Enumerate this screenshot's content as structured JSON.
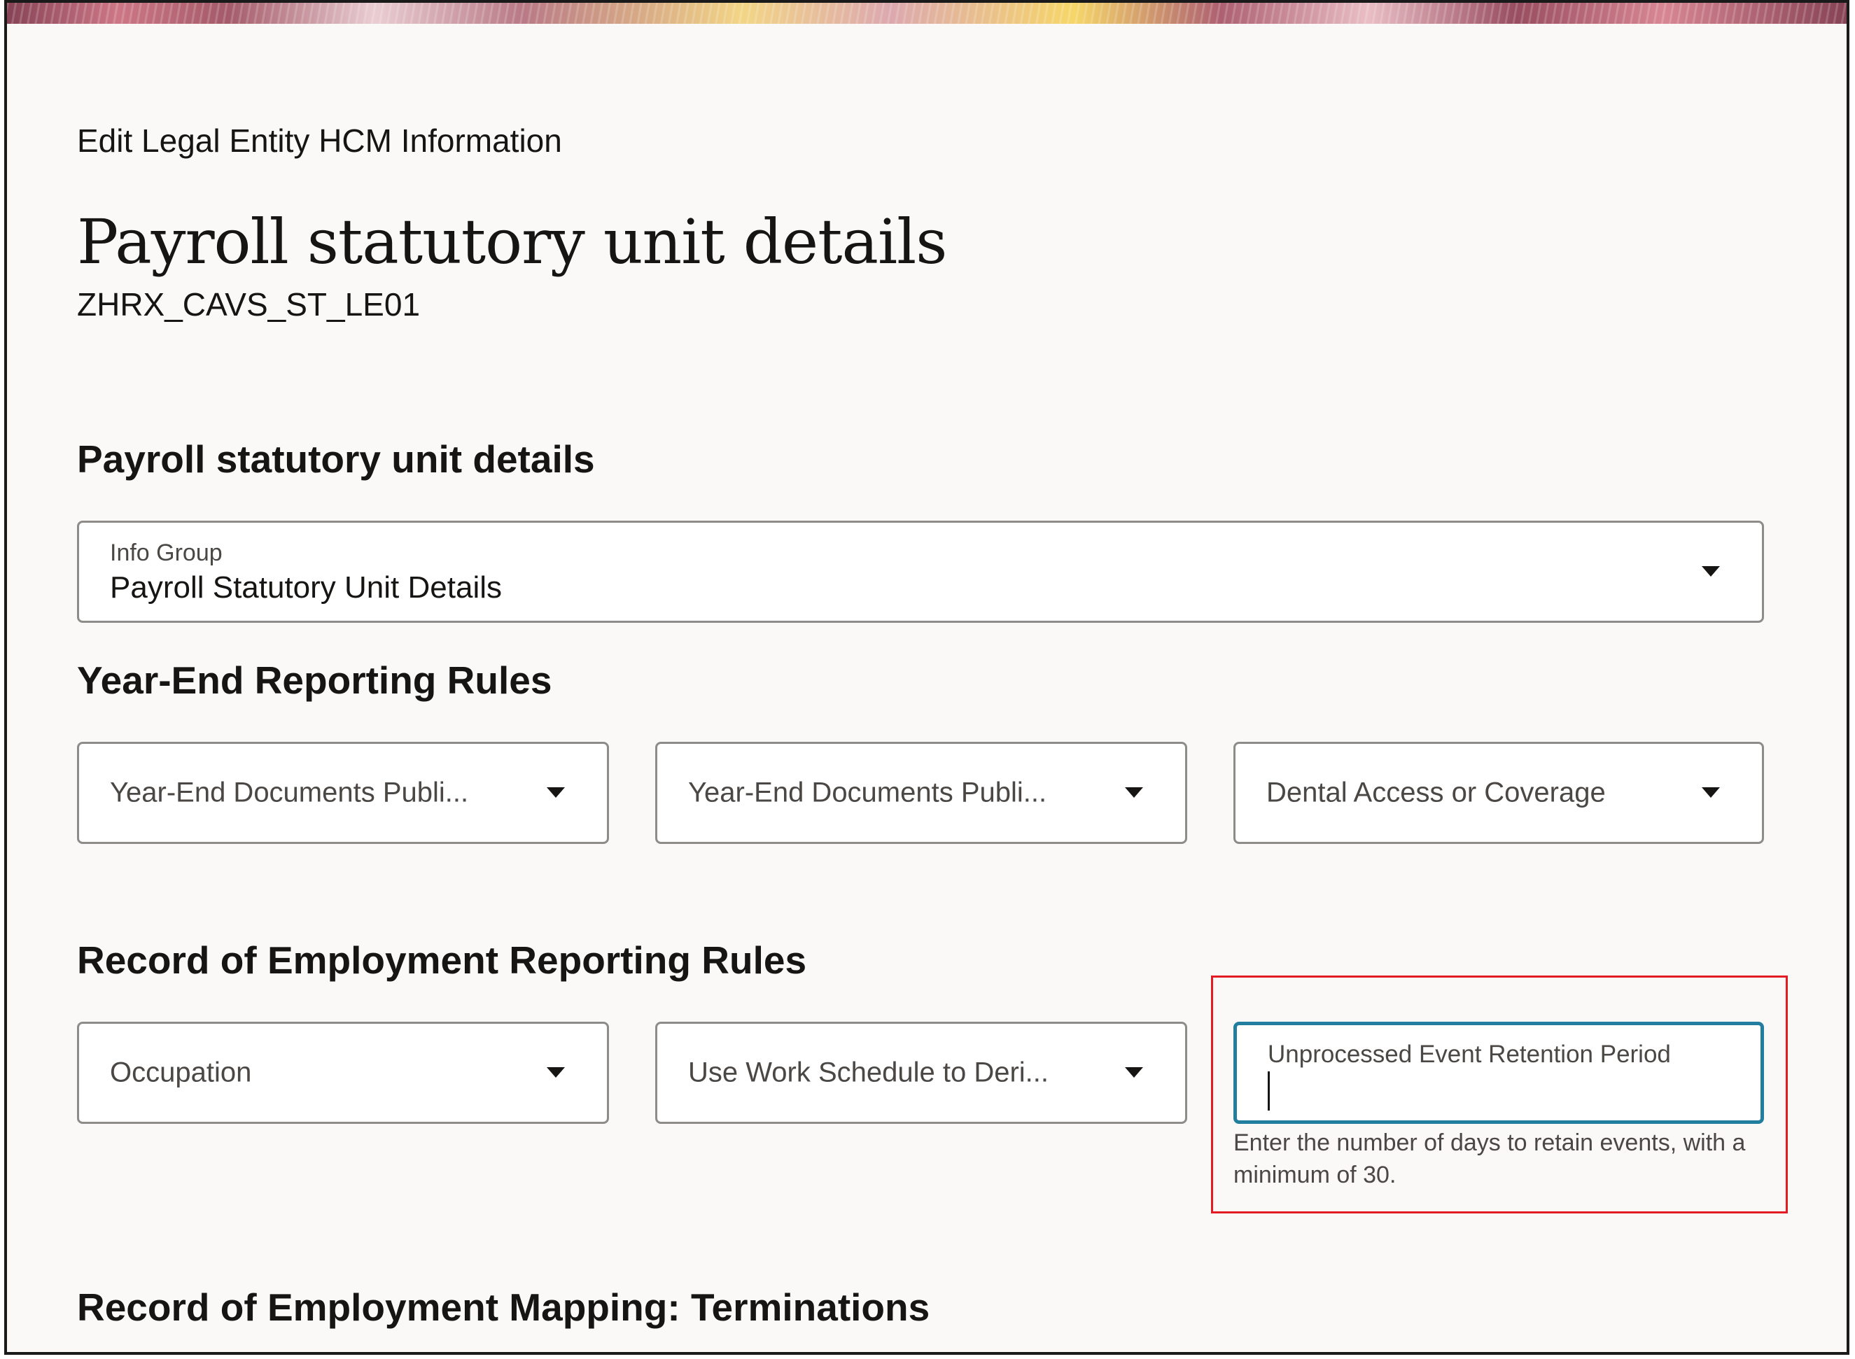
{
  "header": {
    "breadcrumb": "Edit Legal Entity HCM Information",
    "title": "Payroll statutory unit details",
    "subtitle": "ZHRX_CAVS_ST_LE01"
  },
  "sections": {
    "psu_details": {
      "title": "Payroll statutory unit details",
      "info_group_label": "Info Group",
      "info_group_value": "Payroll Statutory Unit Details"
    },
    "year_end": {
      "title": "Year-End Reporting Rules",
      "fields": [
        "Year-End Documents Publi...",
        "Year-End Documents Publi...",
        "Dental Access or Coverage"
      ]
    },
    "roe_rules": {
      "title": "Record of Employment Reporting Rules",
      "fields": [
        "Occupation",
        "Use Work Schedule to Deri..."
      ],
      "retention": {
        "label": "Unprocessed Event Retention Period",
        "value": "",
        "help": "Enter the number of days to retain events, with a minimum of 30."
      }
    },
    "roe_mapping": {
      "title": "Record of Employment Mapping: Terminations"
    }
  },
  "colors": {
    "focus_border": "#227e9e",
    "highlight_box": "#e31b23",
    "page_background": "#fbf9f8"
  }
}
